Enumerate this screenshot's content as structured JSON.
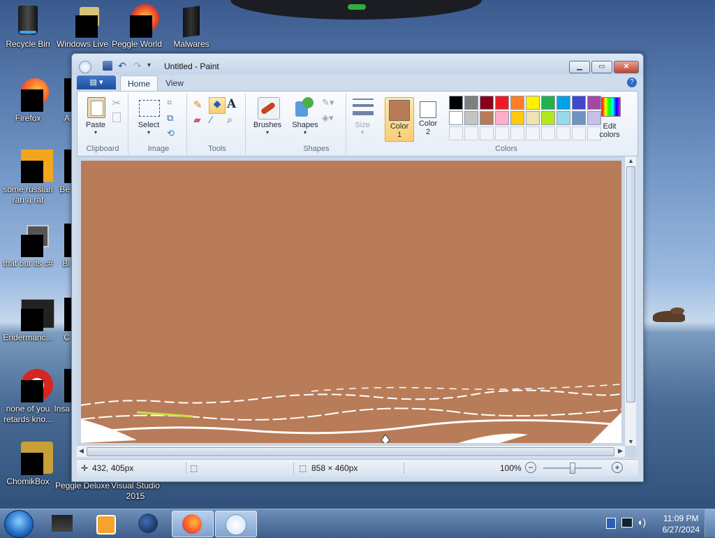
{
  "desktop": {
    "icons": [
      {
        "label": "Recycle Bin"
      },
      {
        "label": "Windows Live"
      },
      {
        "label": "Peggle World"
      },
      {
        "label": "Malwares"
      },
      {
        "label": "Firefox"
      },
      {
        "label": "A"
      },
      {
        "label": "some russian ran a rat"
      },
      {
        "label": "Be"
      },
      {
        "label": "that but its c#"
      },
      {
        "label": "Bi"
      },
      {
        "label": "Endermanc..."
      },
      {
        "label": "C"
      },
      {
        "label": "none of you retards kno..."
      },
      {
        "label": "Insa"
      },
      {
        "label": "ChomikBox"
      },
      {
        "label": "Peggle Deluxe"
      },
      {
        "label": "Visual Studio 2015"
      }
    ]
  },
  "window": {
    "title": "Untitled - Paint",
    "tabs": [
      {
        "label": "Home"
      },
      {
        "label": "View"
      }
    ],
    "ribbon": {
      "clipboard": {
        "title": "Clipboard",
        "paste": "Paste"
      },
      "image": {
        "title": "Image",
        "select": "Select"
      },
      "tools": {
        "title": "Tools"
      },
      "brushes": {
        "label": "Brushes"
      },
      "shapes": {
        "title": "Shapes",
        "label": "Shapes"
      },
      "size": {
        "label": "Size"
      },
      "colors": {
        "title": "Colors",
        "color1_label": "Color",
        "color1_num": "1",
        "color2_label": "Color",
        "color2_num": "2",
        "edit_label": "Edit",
        "edit_label2": "colors",
        "color1": "#b97c58",
        "color2": "#ffffff",
        "palette_row1": [
          "#000000",
          "#7f7f7f",
          "#880015",
          "#ed1c24",
          "#ff7f27",
          "#fff200",
          "#22b14c",
          "#00a2e8",
          "#3f48cc",
          "#a349a4"
        ],
        "palette_row2": [
          "#ffffff",
          "#c3c3c3",
          "#b97a57",
          "#ffaec9",
          "#ffc90e",
          "#efe4b0",
          "#b5e61d",
          "#99d9ea",
          "#7092be",
          "#c8bfe7"
        ]
      }
    },
    "status": {
      "cursor_pos": "432, 405px",
      "canvas_size": "858 × 460px",
      "zoom": "100%"
    }
  },
  "taskbar": {
    "clock_time": "11:09 PM",
    "clock_date": "6/27/2024"
  }
}
